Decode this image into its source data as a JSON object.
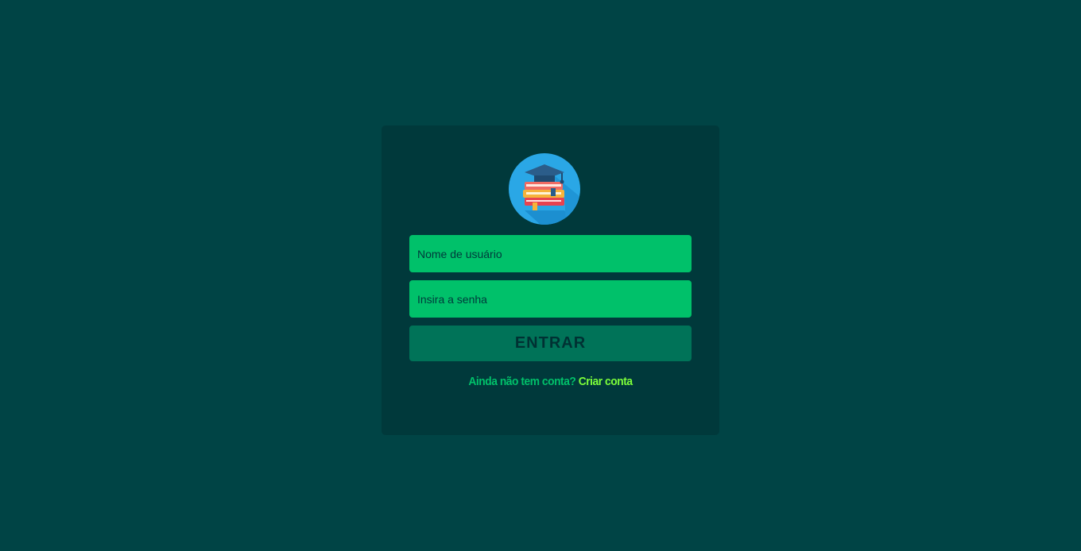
{
  "login": {
    "username_placeholder": "Nome de usuário",
    "password_placeholder": "Insira a senha",
    "submit_label": "ENTRAR",
    "signup_question": "Ainda não tem conta?",
    "signup_link": "Criar conta"
  },
  "logo": {
    "icon": "books-graduation-cap-icon"
  },
  "colors": {
    "background": "#004445",
    "card": "#00393b",
    "input": "#00c16a",
    "button": "#007358",
    "link": "#7cff3a"
  }
}
